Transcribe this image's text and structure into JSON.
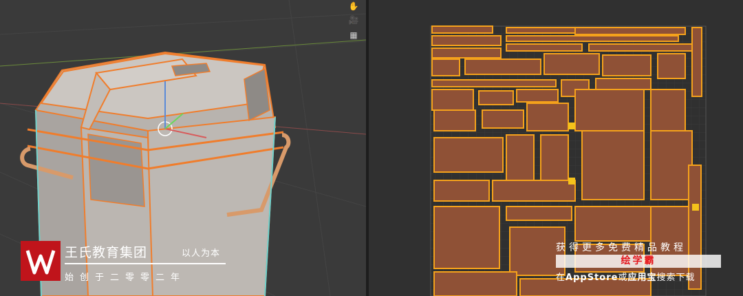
{
  "viewport_3d": {
    "name": "3D Viewport",
    "nav_icons": [
      "hand-pan-icon",
      "camera-icon",
      "grid-view-icon"
    ]
  },
  "uv_editor": {
    "name": "UV Editor"
  },
  "watermark_left": {
    "company": "王氏教育集团",
    "slogan": "以人为本",
    "founded": "始创于二零零二年",
    "logo_color": "#c0141b"
  },
  "watermark_right": {
    "line1": "获得更多免费精品教程",
    "brand": "绘学霸",
    "line3_prefix": "在",
    "line3_store": "AppStore",
    "line3_mid": "或",
    "line3_app": "应用宝",
    "line3_suffix": "搜索下载",
    "brand_color": "#e4141b"
  },
  "colors": {
    "uv_island": "#8f5136",
    "uv_edge": "#f5a21b",
    "selection": "#f07d2c",
    "model_face": "#c9c4c0"
  }
}
